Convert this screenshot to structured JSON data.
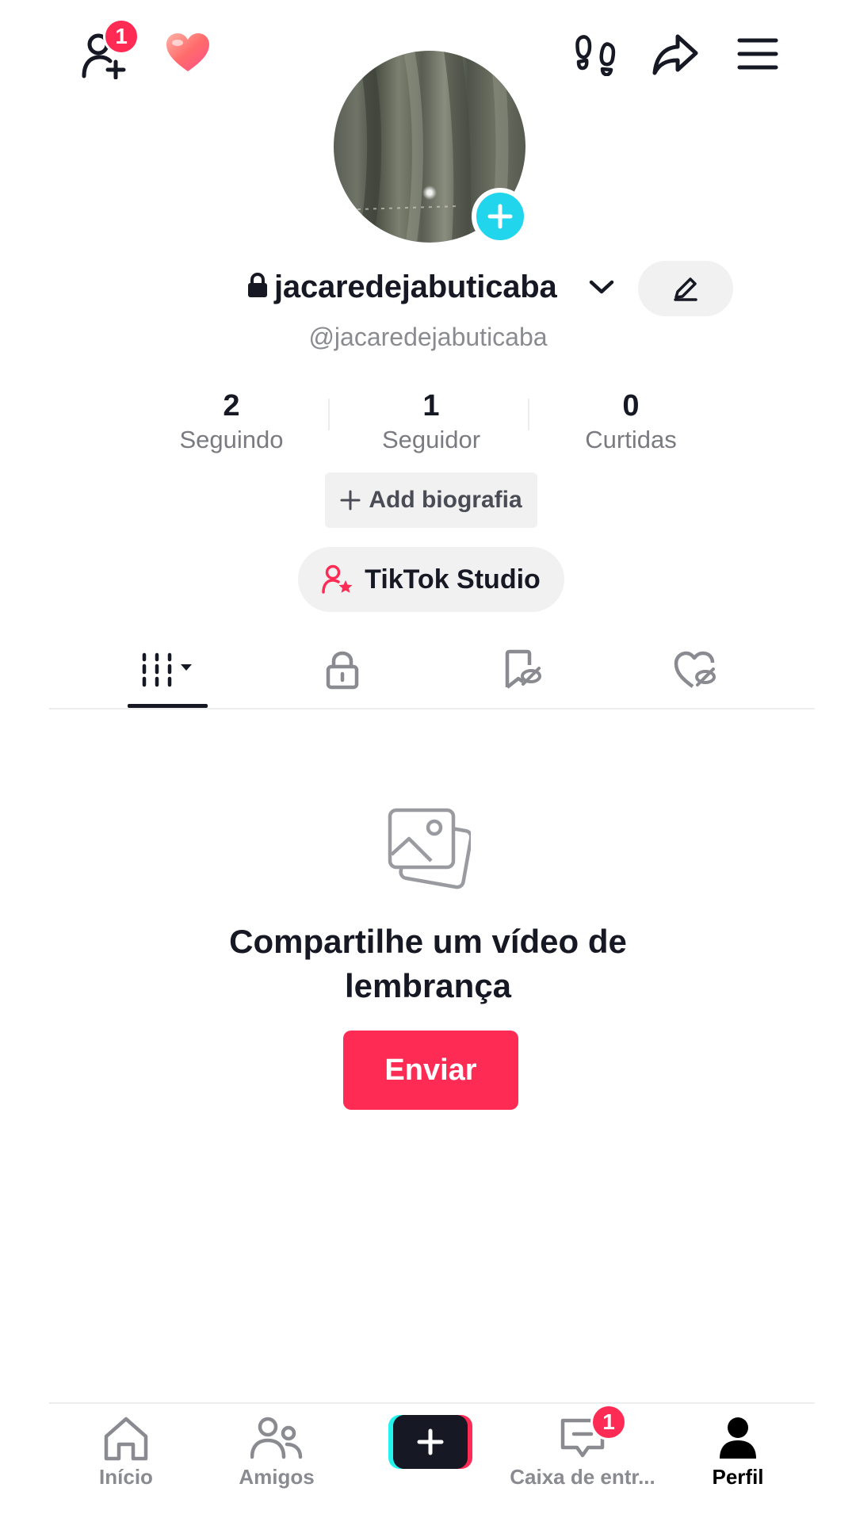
{
  "colors": {
    "accent": "#fe2c55",
    "cyan": "#20d5ec",
    "text": "#161823",
    "muted": "#8a8b91",
    "chip": "#f1f1f2"
  },
  "top_bar": {
    "add_friends_badge": "1",
    "icons": [
      "add-friend-icon",
      "heart-emoji-icon",
      "footprints-icon",
      "share-icon",
      "menu-icon"
    ]
  },
  "profile": {
    "username": "jacaredejabuticaba",
    "handle": "@jacaredejabuticaba",
    "stats": [
      {
        "value": "2",
        "label": "Seguindo"
      },
      {
        "value": "1",
        "label": "Seguidor"
      },
      {
        "value": "0",
        "label": "Curtidas"
      }
    ],
    "add_bio_label": "Add biografia",
    "studio_label": "TikTok Studio"
  },
  "tabs": [
    "videos-grid-tab",
    "private-tab",
    "favorites-tab",
    "liked-tab"
  ],
  "empty_state": {
    "title_line1": "Compartilhe um vídeo de",
    "title_line2": "lembrança",
    "button_label": "Enviar"
  },
  "bottom_nav": {
    "items": [
      {
        "label": "Início"
      },
      {
        "label": "Amigos"
      },
      {
        "label": "Caixa de entr..."
      },
      {
        "label": "Perfil"
      }
    ],
    "inbox_badge": "1"
  }
}
